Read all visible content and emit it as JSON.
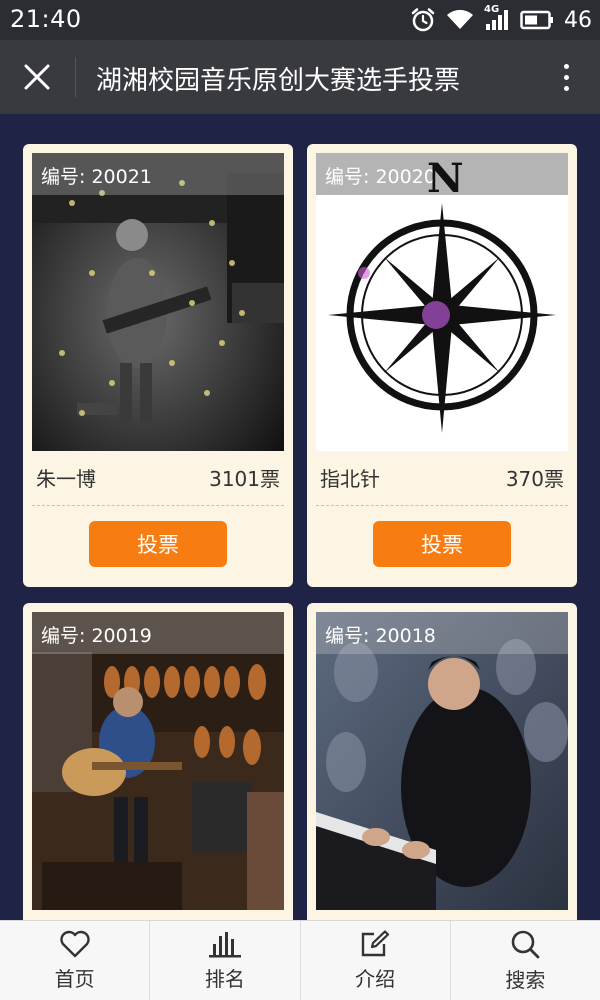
{
  "status_bar": {
    "time": "21:40",
    "network": "4G",
    "battery": "46",
    "icons": [
      "alarm-icon",
      "wifi-icon",
      "signal-icon",
      "battery-icon"
    ]
  },
  "header": {
    "title": "湖湘校园音乐原创大赛选手投票",
    "close_icon": "close-icon",
    "more_icon": "more-vertical-icon"
  },
  "contestants": [
    {
      "id_text": "编号: 20021",
      "name": "朱一博",
      "votes": "3101票",
      "vote_label": "投票",
      "photo": "guitarist-studio-photo"
    },
    {
      "id_text": "编号: 20020",
      "name": "指北针",
      "votes": "370票",
      "vote_label": "投票",
      "photo": "compass-rose-logo",
      "logo_letter": "N"
    },
    {
      "id_text": "编号: 20019",
      "photo": "acoustic-guitarist-shop-photo"
    },
    {
      "id_text": "编号: 20018",
      "photo": "keyboard-player-photo"
    }
  ],
  "nav": [
    {
      "label": "首页",
      "icon": "heart-icon"
    },
    {
      "label": "排名",
      "icon": "bar-chart-icon"
    },
    {
      "label": "介绍",
      "icon": "edit-icon"
    },
    {
      "label": "搜索",
      "icon": "search-icon"
    }
  ],
  "colors": {
    "background": "#1f2447",
    "card": "#fcf5e3",
    "vote_button": "#f77d12",
    "title_bar": "#393a3f",
    "status_bar": "#2b2d32"
  }
}
